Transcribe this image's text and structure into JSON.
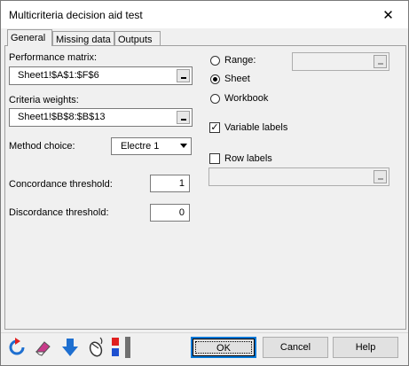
{
  "window": {
    "title": "Multicriteria decision aid test",
    "close_glyph": "✕"
  },
  "tabs": [
    {
      "label": "General",
      "active": true
    },
    {
      "label": "Missing data",
      "active": false
    },
    {
      "label": "Outputs",
      "active": false
    }
  ],
  "general": {
    "performance_matrix": {
      "label": "Performance matrix:",
      "value": "Sheet1!$A$1:$F$6"
    },
    "criteria_weights": {
      "label": "Criteria weights:",
      "value": "Sheet1!$B$8:$B$13"
    },
    "method_choice": {
      "label": "Method choice:",
      "value": "Electre 1"
    },
    "concordance_threshold": {
      "label": "Concordance threshold:",
      "value": "1"
    },
    "discordance_threshold": {
      "label": "Discordance threshold:",
      "value": "0"
    },
    "output_location": {
      "options": [
        {
          "label": "Range:",
          "checked": false
        },
        {
          "label": "Sheet",
          "checked": true
        },
        {
          "label": "Workbook",
          "checked": false
        }
      ],
      "range_value": ""
    },
    "variable_labels": {
      "label": "Variable labels",
      "checked": true,
      "mark": "✓"
    },
    "row_labels": {
      "label": "Row labels",
      "checked": false,
      "value": ""
    }
  },
  "footer": {
    "icons": [
      "reset-icon",
      "eraser-icon",
      "down-arrow-icon",
      "mouse-icon",
      "color-squares-icon"
    ],
    "ok_label": "OK",
    "cancel_label": "Cancel",
    "help_label": "Help"
  },
  "colors": {
    "accent": "#0078d7",
    "icon_blue": "#1e6fd0",
    "icon_red": "#e02020"
  }
}
